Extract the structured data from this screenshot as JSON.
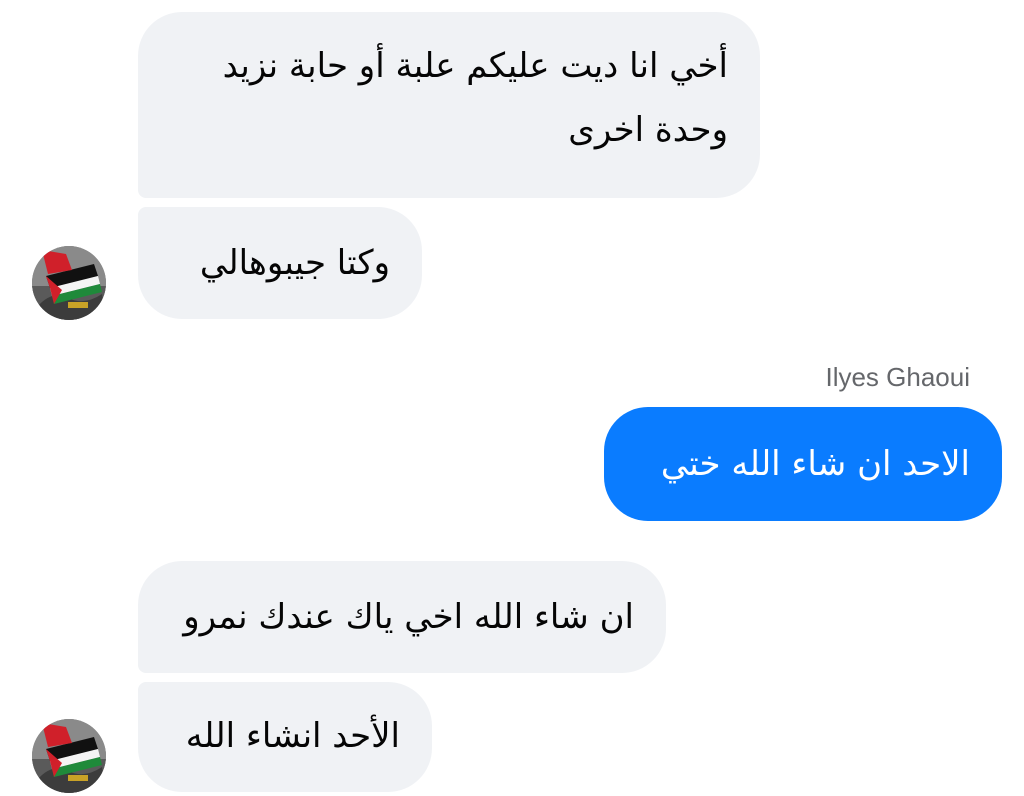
{
  "conversation": {
    "messages": [
      {
        "sender": "other",
        "text": "أخي انا ديت عليكم علبة أو حابة نزيد وحدة اخرى"
      },
      {
        "sender": "other",
        "text": "وكتا جيبوهالي"
      },
      {
        "sender": "me",
        "sender_name": "Ilyes Ghaoui",
        "text": "الاحد ان شاء الله ختي"
      },
      {
        "sender": "other",
        "text": "ان شاء الله اخي ياك عندك نمرو"
      },
      {
        "sender": "other",
        "text": "الأحد انشاء الله"
      }
    ]
  },
  "colors": {
    "incoming_bubble": "#f0f2f5",
    "outgoing_bubble": "#0a7cff",
    "sender_label": "#65676b"
  },
  "icons": {
    "avatar": "palestine-flag-avatar"
  }
}
